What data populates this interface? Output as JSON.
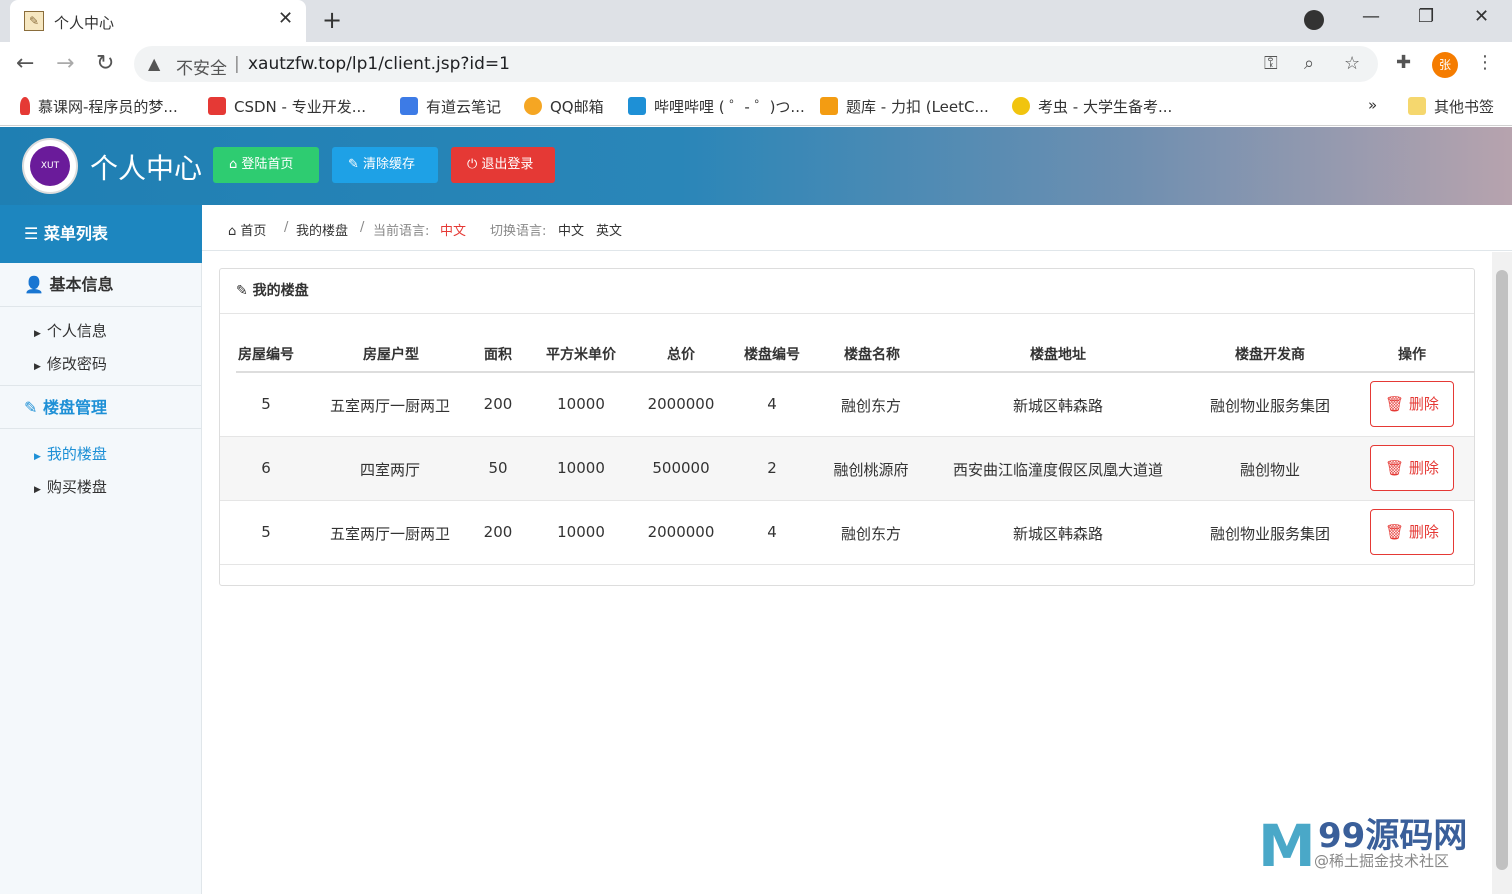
{
  "browser": {
    "tab_title": "个人中心",
    "tab_close": "✕",
    "new_tab": "+",
    "insecure_label": "不安全",
    "url": "xautzfw.top/lp1/client.jsp?id=1",
    "avatar_letter": "张",
    "bookmarks": [
      {
        "label": "慕课网-程序员的梦...",
        "color": "#e53935"
      },
      {
        "label": "CSDN - 专业开发...",
        "color": "#e53935"
      },
      {
        "label": "有道云笔记",
        "color": "#3d7be6"
      },
      {
        "label": "QQ邮箱",
        "color": "#f5a623"
      },
      {
        "label": "哔哩哔哩 ( ゜- ゜)つ...",
        "color": "#1e90d6"
      },
      {
        "label": "题库 - 力扣 (LeetC...",
        "color": "#f39c12"
      },
      {
        "label": "考虫 - 大学生备考...",
        "color": "#f1c40f"
      }
    ],
    "bookmarks_more": "»",
    "other_bookmarks": "其他书签"
  },
  "header": {
    "logo_text": "XUT",
    "title": "个人中心",
    "buttons": {
      "home": "登陆首页",
      "clear": "清除缓存",
      "logout": "退出登录"
    }
  },
  "sidebar": {
    "menu_title": "菜单列表",
    "sections": [
      {
        "title": "基本信息",
        "items": [
          "个人信息",
          "修改密码"
        ]
      },
      {
        "title": "楼盘管理",
        "items": [
          "我的楼盘",
          "购买楼盘"
        ]
      }
    ]
  },
  "breadcrumb": {
    "home": "首页",
    "current": "我的楼盘",
    "lang_label": "当前语言:",
    "lang_value": "中文",
    "switch_label": "切换语言:",
    "lang_zh": "中文",
    "lang_en": "英文"
  },
  "panel": {
    "title": "我的楼盘",
    "columns": [
      "房屋编号",
      "房屋户型",
      "面积",
      "平方米单价",
      "总价",
      "楼盘编号",
      "楼盘名称",
      "楼盘地址",
      "楼盘开发商",
      "操作"
    ],
    "rows": [
      [
        "5",
        "五室两厅一厨两卫",
        "200",
        "10000",
        "2000000",
        "4",
        "融创东方",
        "新城区韩森路",
        "融创物业服务集团"
      ],
      [
        "6",
        "四室两厅",
        "50",
        "10000",
        "500000",
        "2",
        "融创桃源府",
        "西安曲江临潼度假区凤凰大道道",
        "融创物业"
      ],
      [
        "5",
        "五室两厅一厨两卫",
        "200",
        "10000",
        "2000000",
        "4",
        "融创东方",
        "新城区韩森路",
        "融创物业服务集团"
      ]
    ],
    "delete_label": "删除"
  },
  "watermark": {
    "logo": "M",
    "text": "99源码网",
    "sub": "@稀土掘金技术社区"
  },
  "colors": {
    "accent": "#1e90d6",
    "green": "#2ecc71",
    "blue": "#1ea1e6",
    "red": "#e53935"
  }
}
